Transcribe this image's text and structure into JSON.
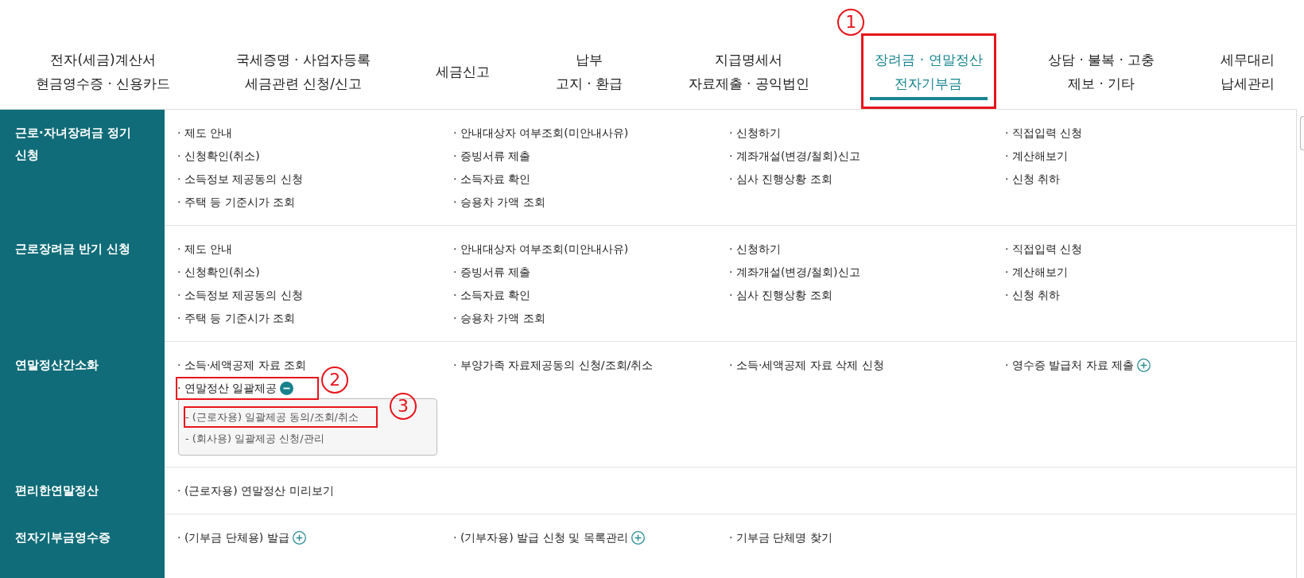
{
  "nav": {
    "tabs": [
      {
        "label": "전자(세금)계산서\n현금영수증 · 신용카드",
        "selected": false,
        "highlighted": false
      },
      {
        "label": "국세증명 · 사업자등록\n세금관련 신청/신고",
        "selected": false,
        "highlighted": false
      },
      {
        "label": "세금신고",
        "selected": false,
        "highlighted": false
      },
      {
        "label": "납부\n고지 · 환급",
        "selected": false,
        "highlighted": false
      },
      {
        "label": "지급명세서\n자료제출 · 공익법인",
        "selected": false,
        "highlighted": false
      },
      {
        "label": "장려금 · 연말정산\n전자기부금",
        "selected": true,
        "highlighted": true,
        "callout": "1"
      },
      {
        "label": "상담 · 불복 · 고충\n제보 · 기타",
        "selected": false,
        "highlighted": false
      },
      {
        "label": "세무대리\n납세관리",
        "selected": false,
        "highlighted": false
      }
    ]
  },
  "menu": {
    "rows": [
      {
        "title": "근로·자녀장려금 정기 신청",
        "items": [
          {
            "label": "· 제도 안내",
            "highlighted": false
          },
          {
            "label": "· 안내대상자 여부조회(미안내사유)",
            "highlighted": false
          },
          {
            "label": "· 신청하기",
            "highlighted": false
          },
          {
            "label": "· 직접입력 신청",
            "highlighted": false
          },
          {
            "label": "· 신청확인(취소)",
            "highlighted": false
          },
          {
            "label": "· 증빙서류 제출",
            "highlighted": false
          },
          {
            "label": "· 계좌개설(변경/철회)신고",
            "highlighted": false
          },
          {
            "label": "· 계산해보기",
            "highlighted": false
          },
          {
            "label": "· 소득정보 제공동의 신청",
            "highlighted": false
          },
          {
            "label": "· 소득자료 확인",
            "highlighted": false
          },
          {
            "label": "· 심사 진행상황 조회",
            "highlighted": false
          },
          {
            "label": "· 신청 취하",
            "highlighted": false
          },
          {
            "label": "· 주택 등 기준시가 조회",
            "highlighted": false
          },
          {
            "label": "· 승용차 가액 조회",
            "highlighted": false
          }
        ]
      },
      {
        "title": "근로장려금 반기 신청",
        "items": [
          {
            "label": "· 제도 안내",
            "highlighted": false
          },
          {
            "label": "· 안내대상자 여부조회(미안내사유)",
            "highlighted": false
          },
          {
            "label": "· 신청하기",
            "highlighted": false
          },
          {
            "label": "· 직접입력 신청",
            "highlighted": false
          },
          {
            "label": "· 신청확인(취소)",
            "highlighted": false
          },
          {
            "label": "· 증빙서류 제출",
            "highlighted": false
          },
          {
            "label": "· 계좌개설(변경/철회)신고",
            "highlighted": false
          },
          {
            "label": "· 계산해보기",
            "highlighted": false
          },
          {
            "label": "· 소득정보 제공동의 신청",
            "highlighted": false
          },
          {
            "label": "· 소득자료 확인",
            "highlighted": false
          },
          {
            "label": "· 심사 진행상황 조회",
            "highlighted": false
          },
          {
            "label": "· 신청 취하",
            "highlighted": false
          },
          {
            "label": "· 주택 등 기준시가 조회",
            "highlighted": false
          },
          {
            "label": "· 승용차 가액 조회",
            "highlighted": false
          }
        ]
      },
      {
        "title": "연말정산간소화",
        "items": [
          {
            "label": "· 소득·세액공제 자료 조회",
            "highlighted": false
          },
          {
            "label": "· 부양가족 자료제공동의 신청/조회/취소",
            "highlighted": false
          },
          {
            "label": "· 소득·세액공제 자료 삭제 신청",
            "highlighted": false
          },
          {
            "label": "· 영수증 발급처 자료 제출",
            "highlighted": false,
            "expanded": false
          },
          {
            "label": "· 연말정산 일괄제공",
            "highlighted": true,
            "callout": "2",
            "expanded": true,
            "children": [
              {
                "label": "- (근로자용) 일괄제공 동의/조회/취소",
                "highlighted": true,
                "callout": "3"
              },
              {
                "label": "- (회사용) 일괄제공 신청/관리",
                "highlighted": false
              }
            ]
          }
        ]
      },
      {
        "title": "편리한연말정산",
        "items": [
          {
            "label": "· (근로자용) 연말정산 미리보기",
            "highlighted": false
          }
        ]
      },
      {
        "title": "전자기부금영수증",
        "items": [
          {
            "label": "· (기부금 단체용) 발급",
            "highlighted": false,
            "expanded": false
          },
          {
            "label": "· (기부자용) 발급 신청 및 목록관리",
            "highlighted": false,
            "expanded": false
          },
          {
            "label": "· 기부금 단체명 찾기",
            "highlighted": false
          }
        ]
      }
    ]
  }
}
